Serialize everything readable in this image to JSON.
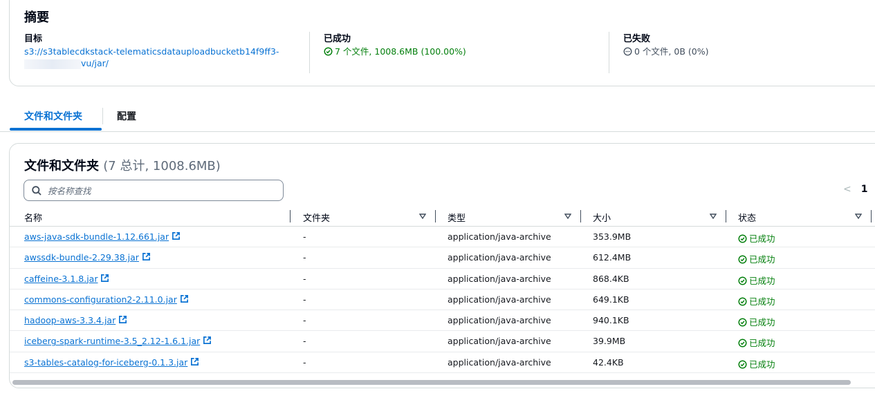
{
  "summary": {
    "title": "摘要",
    "target": {
      "label": "目标",
      "line1": "s3://s3tablecdkstack-telematicsdatauploadbucketb14f9ff3-",
      "line2": "vu/jar/"
    },
    "succeeded": {
      "label": "已成功",
      "value": "7 个文件, 1008.6MB (100.00%)"
    },
    "failed": {
      "label": "已失败",
      "value": "0 个文件, 0B (0%)"
    }
  },
  "tabs": [
    {
      "label": "文件和文件夹",
      "active": true
    },
    {
      "label": "配置",
      "active": false
    }
  ],
  "files": {
    "title": "文件和文件夹",
    "count": "(7 总计, 1008.6MB)",
    "search_placeholder": "按名称查找",
    "pagination": {
      "prev": "<",
      "current": "1"
    },
    "columns": [
      "名称",
      "文件夹",
      "类型",
      "大小",
      "状态"
    ],
    "rows": [
      {
        "name": "aws-java-sdk-bundle-1.12.661.jar",
        "folder": "-",
        "type": "application/java-archive",
        "size": "353.9MB",
        "status": "已成功"
      },
      {
        "name": "awssdk-bundle-2.29.38.jar",
        "folder": "-",
        "type": "application/java-archive",
        "size": "612.4MB",
        "status": "已成功"
      },
      {
        "name": "caffeine-3.1.8.jar",
        "folder": "-",
        "type": "application/java-archive",
        "size": "868.4KB",
        "status": "已成功"
      },
      {
        "name": "commons-configuration2-2.11.0.jar",
        "folder": "-",
        "type": "application/java-archive",
        "size": "649.1KB",
        "status": "已成功"
      },
      {
        "name": "hadoop-aws-3.3.4.jar",
        "folder": "-",
        "type": "application/java-archive",
        "size": "940.1KB",
        "status": "已成功"
      },
      {
        "name": "iceberg-spark-runtime-3.5_2.12-1.6.1.jar",
        "folder": "-",
        "type": "application/java-archive",
        "size": "39.9MB",
        "status": "已成功"
      },
      {
        "name": "s3-tables-catalog-for-iceberg-0.1.3.jar",
        "folder": "-",
        "type": "application/java-archive",
        "size": "42.4KB",
        "status": "已成功"
      }
    ]
  },
  "colors": {
    "link": "#0972d3",
    "success": "#037f0c",
    "border": "#d5dbdb"
  }
}
